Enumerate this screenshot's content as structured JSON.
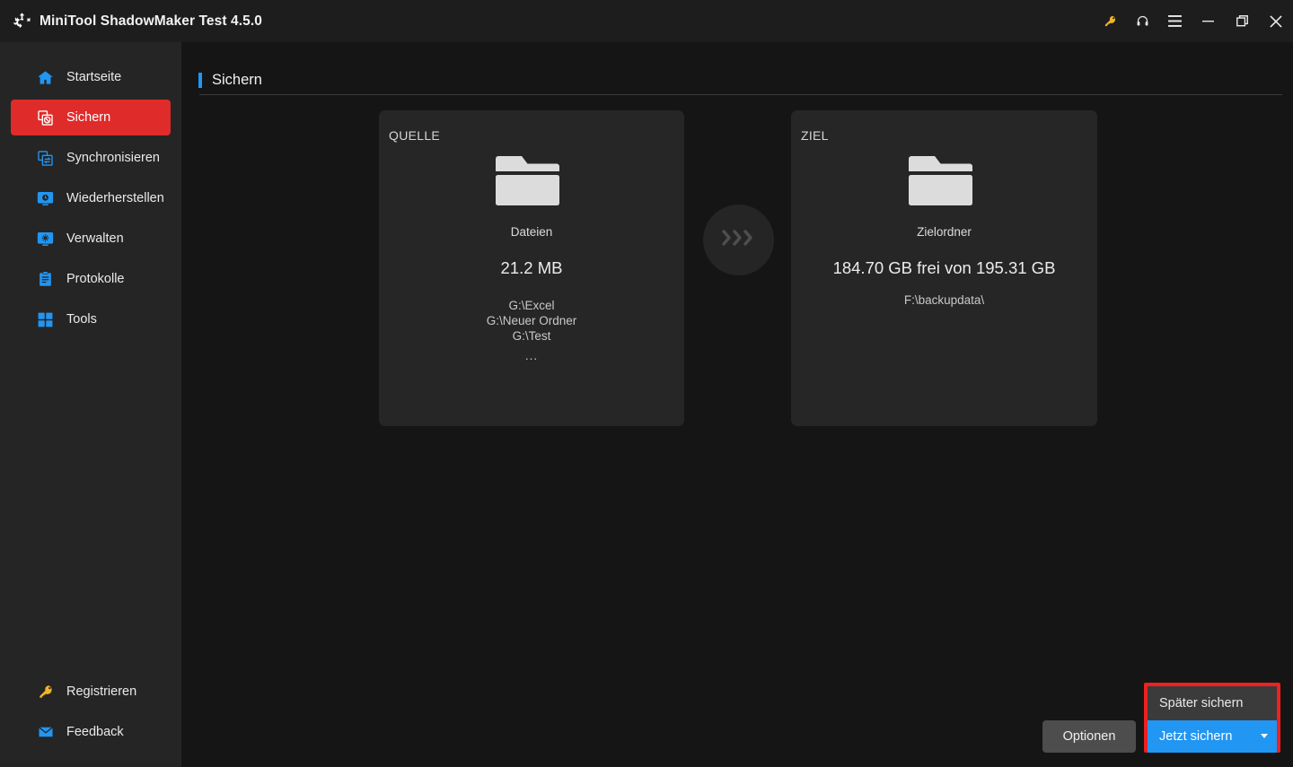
{
  "window": {
    "title": "MiniTool ShadowMaker Test 4.5.0",
    "logo_icon": "shadowmaker-logo-icon",
    "controls": [
      {
        "name": "license-key-icon",
        "glyph": "key"
      },
      {
        "name": "support-headset-icon",
        "glyph": "headset"
      },
      {
        "name": "menu-hamburger-icon",
        "glyph": "menu"
      },
      {
        "name": "minimize-icon",
        "glyph": "minimize"
      },
      {
        "name": "restore-icon",
        "glyph": "restore"
      },
      {
        "name": "close-icon",
        "glyph": "close"
      }
    ]
  },
  "sidebar": {
    "items": [
      {
        "label": "Startseite",
        "icon": "home-icon",
        "active": false
      },
      {
        "label": "Sichern",
        "icon": "backup-icon",
        "active": true
      },
      {
        "label": "Synchronisieren",
        "icon": "sync-icon",
        "active": false
      },
      {
        "label": "Wiederherstellen",
        "icon": "restore-monitor-icon",
        "active": false
      },
      {
        "label": "Verwalten",
        "icon": "manage-gear-icon",
        "active": false
      },
      {
        "label": "Protokolle",
        "icon": "logs-clipboard-icon",
        "active": false
      },
      {
        "label": "Tools",
        "icon": "tools-grid-icon",
        "active": false
      }
    ],
    "bottom_items": [
      {
        "label": "Registrieren",
        "icon": "key-icon"
      },
      {
        "label": "Feedback",
        "icon": "mail-icon"
      }
    ]
  },
  "page": {
    "title": "Sichern",
    "accent_color": "#2196f3"
  },
  "source_card": {
    "kicker": "QUELLE",
    "icon": "folder-icon",
    "type": "Dateien",
    "size": "21.2 MB",
    "paths": [
      "G:\\Excel",
      "G:\\Neuer Ordner",
      "G:\\Test"
    ],
    "more": "..."
  },
  "transfer_arrow": {
    "icon": "chevrons-right-icon"
  },
  "dest_card": {
    "kicker": "ZIEL",
    "icon": "folder-icon",
    "type": "Zielordner",
    "size": "184.70 GB frei von 195.31 GB",
    "paths": [
      "F:\\backupdata\\"
    ]
  },
  "footer": {
    "options_label": "Optionen",
    "later_label": "Später sichern",
    "now_label": "Jetzt sichern",
    "highlight_color": "#ef2020",
    "primary_color": "#2196f3"
  }
}
